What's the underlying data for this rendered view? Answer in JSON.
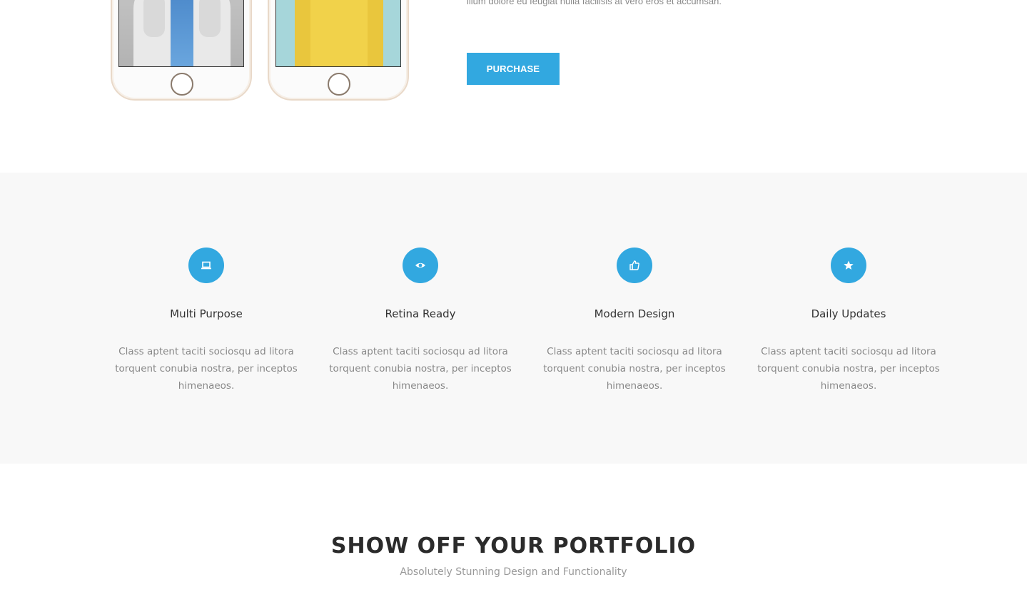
{
  "top": {
    "body_text": "illum dolore eu feugiat nulla facilisis at vero eros et accumsan.",
    "purchase_label": "PURCHASE"
  },
  "features": {
    "items": [
      {
        "icon": "laptop-icon",
        "title": "Multi Purpose",
        "desc": "Class aptent taciti sociosqu ad litora torquent conubia nostra, per inceptos himenaeos."
      },
      {
        "icon": "eye-icon",
        "title": "Retina Ready",
        "desc": "Class aptent taciti sociosqu ad litora torquent conubia nostra, per inceptos himenaeos."
      },
      {
        "icon": "thumbs-up-icon",
        "title": "Modern Design",
        "desc": "Class aptent taciti sociosqu ad litora torquent conubia nostra, per inceptos himenaeos."
      },
      {
        "icon": "star-icon",
        "title": "Daily Updates",
        "desc": "Class aptent taciti sociosqu ad litora torquent conubia nostra, per inceptos himenaeos."
      }
    ]
  },
  "portfolio": {
    "heading": "SHOW OFF YOUR PORTFOLIO",
    "subheading": "Absolutely Stunning Design and Functionality"
  },
  "colors": {
    "accent": "#32a8e0",
    "section_bg": "#f8f8f8"
  }
}
